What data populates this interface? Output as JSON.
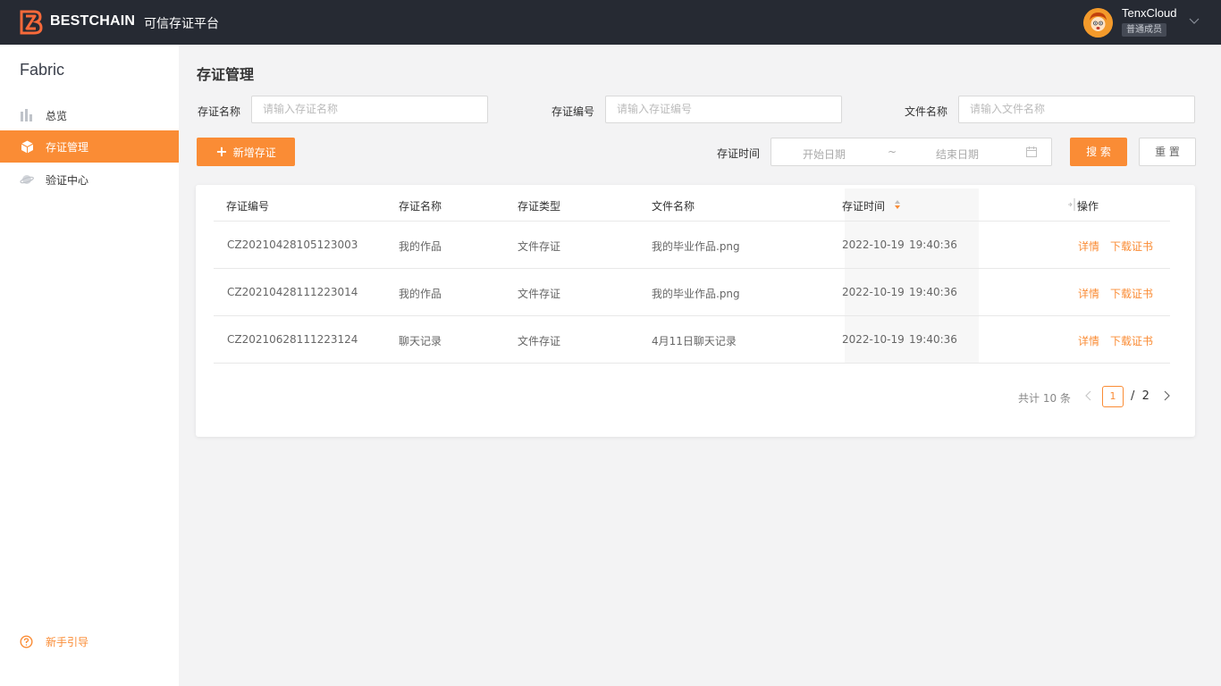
{
  "topbar": {
    "brand": "BESTCHAIN",
    "subtitle": "可信存证平台",
    "user_name": "TenxCloud",
    "user_role": "普通成员"
  },
  "sidebar": {
    "title": "Fabric",
    "items": [
      {
        "label": "总览",
        "icon": "bar-chart-icon",
        "active": false
      },
      {
        "label": "存证管理",
        "icon": "cube-icon",
        "active": true
      },
      {
        "label": "验证中心",
        "icon": "planet-icon",
        "active": false
      }
    ],
    "guide": "新手引导"
  },
  "main": {
    "title": "存证管理",
    "filters": {
      "name_label": "存证名称",
      "name_placeholder": "请输入存证名称",
      "code_label": "存证编号",
      "code_placeholder": "请输入存证编号",
      "file_label": "文件名称",
      "file_placeholder": "请输入文件名称",
      "time_label": "存证时间",
      "start_placeholder": "开始日期",
      "separator": "~",
      "end_placeholder": "结束日期"
    },
    "add_button": "新增存证",
    "search_button": "搜 索",
    "reset_button": "重 置"
  },
  "table": {
    "columns": [
      "存证编号",
      "存证名称",
      "存证类型",
      "文件名称",
      "存证时间",
      "操作"
    ],
    "rows": [
      {
        "code": "CZ20210428105123003",
        "name": "我的作品",
        "type": "文件存证",
        "file": "我的毕业作品.png",
        "date": "2022-10-19",
        "time": "19:40:36",
        "action1": "详情",
        "action2": "下载证书"
      },
      {
        "code": "CZ20210428111223014",
        "name": "我的作品",
        "type": "文件存证",
        "file": "我的毕业作品.png",
        "date": "2022-10-19",
        "time": "19:40:36",
        "action1": "详情",
        "action2": "下载证书"
      },
      {
        "code": "CZ20210628111223124",
        "name": "聊天记录",
        "type": "文件存证",
        "file": "4月11日聊天记录",
        "date": "2022-10-19",
        "time": "19:40:36",
        "action1": "详情",
        "action2": "下载证书"
      }
    ]
  },
  "pagination": {
    "total_text": "共计 10 条",
    "current_page": "1",
    "separator": "/",
    "total_pages": "2"
  },
  "colors": {
    "accent": "#fa8c35",
    "topbar": "#262a33"
  }
}
